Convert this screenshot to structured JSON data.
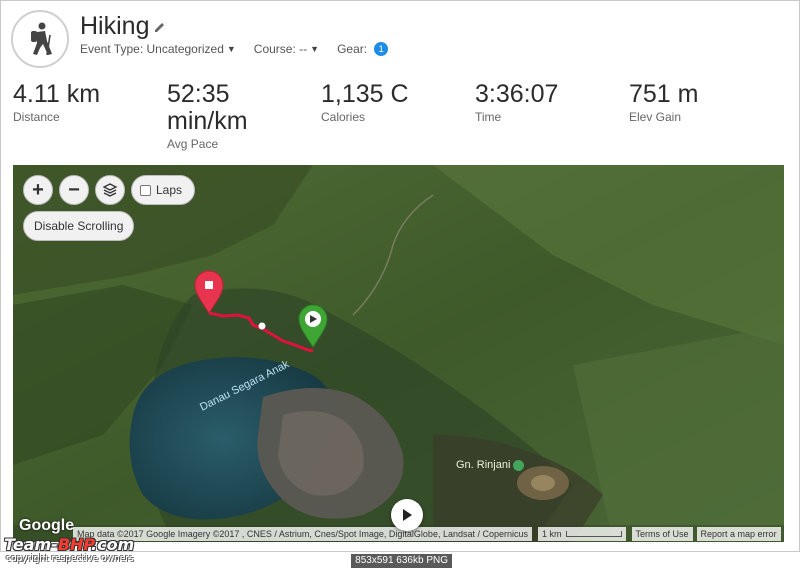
{
  "activity": {
    "title": "Hiking",
    "event_type": "Event Type: Uncategorized",
    "course": "Course: --",
    "gear_label": "Gear:",
    "gear_count": "1"
  },
  "stats": [
    {
      "value": "4.11 km",
      "label": "Distance"
    },
    {
      "value": "52:35 min/km",
      "label": "Avg Pace"
    },
    {
      "value": "1,135 C",
      "label": "Calories"
    },
    {
      "value": "3:36:07",
      "label": "Time"
    },
    {
      "value": "751 m",
      "label": "Elev Gain"
    }
  ],
  "map": {
    "zoom_in": "+",
    "zoom_out": "−",
    "laps_label": "Laps",
    "laps_checked": false,
    "disable_scrolling": "Disable Scrolling",
    "lake_label": "Danau Segara Anak",
    "peak_label": "Gn. Rinjani",
    "google": "Google",
    "attribution": "Map data ©2017 Google Imagery ©2017 , CNES / Astrium, Cnes/Spot Image, DigitalGlobe, Landsat / Copernicus",
    "scale": "1 km",
    "terms": "Terms of Use",
    "report": "Report a map error",
    "colors": {
      "route": "#e0123d",
      "start_marker": "#3fa535",
      "end_marker": "#e8344e"
    }
  },
  "watermark": {
    "brand_a": "Team-",
    "brand_b": "BHP",
    "brand_c": ".com",
    "sub": "copyright respective owners",
    "image_info": "853x591  636kb  PNG"
  }
}
